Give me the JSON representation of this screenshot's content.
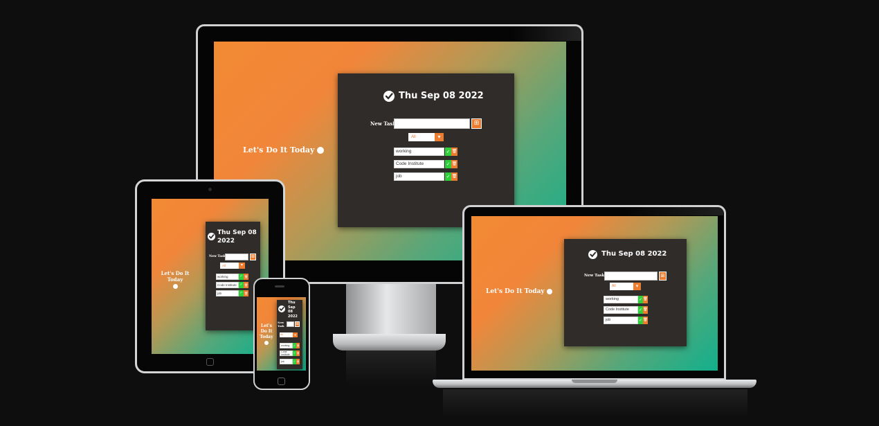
{
  "app": {
    "date": "Thu Sep 08 2022",
    "date_parts": [
      "Thu",
      "Sep",
      "08",
      "2022"
    ],
    "tagline": "Let's Do It Today",
    "new_task_label": "New Task",
    "new_task_value": "",
    "add_button_icon": "⊞",
    "filter": {
      "selected": "All",
      "arrow": "▾"
    },
    "tasks": [
      {
        "text": "working",
        "ok": "✓",
        "delete": "🗑"
      },
      {
        "text": "Code Institute",
        "ok": "✓",
        "delete": "🗑"
      },
      {
        "text": "job",
        "ok": "✓",
        "delete": "🗑"
      }
    ]
  },
  "colors": {
    "page_background": "#0f0e0e",
    "gradient_start": "#f28a33",
    "gradient_end": "#11b08c",
    "card": "#2f2c2a",
    "accent": "#ee7c2e",
    "complete": "#31cf3b"
  },
  "icons": {
    "date": "check-circle-icon",
    "add": "plus-square-icon",
    "dropdown": "chevron-down-icon",
    "complete": "check-icon",
    "delete": "trash-icon",
    "tagline": "smiley-icon"
  },
  "devices": [
    "desktop-monitor",
    "tablet",
    "phone",
    "laptop"
  ]
}
